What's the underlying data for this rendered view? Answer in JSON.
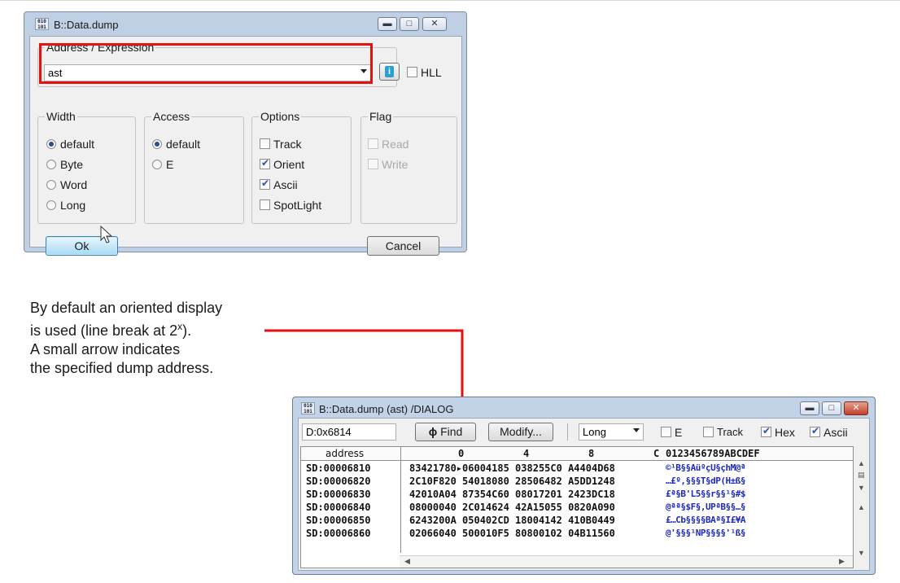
{
  "dialog1": {
    "title": "B::Data.dump",
    "app_icon_top": "010",
    "app_icon_bottom": "101",
    "window_buttons": [
      "minimize-icon",
      "maximize-icon",
      "close-icon"
    ],
    "address_group_label": "Address / Expression",
    "address_value": "ast",
    "hll_label": "HLL",
    "hll_checked": false,
    "width_group": {
      "label": "Width",
      "options": [
        "default",
        "Byte",
        "Word",
        "Long"
      ],
      "selected": "default"
    },
    "access_group": {
      "label": "Access",
      "options": [
        "default",
        "E"
      ],
      "selected": "default"
    },
    "options_group": {
      "label": "Options",
      "items": [
        {
          "label": "Track",
          "checked": false
        },
        {
          "label": "Orient",
          "checked": true
        },
        {
          "label": "Ascii",
          "checked": true
        },
        {
          "label": "SpotLight",
          "checked": false
        }
      ]
    },
    "flag_group": {
      "label": "Flag",
      "items": [
        {
          "label": "Read",
          "checked": false,
          "disabled": true
        },
        {
          "label": "Write",
          "checked": false,
          "disabled": true
        }
      ]
    },
    "ok_label": "Ok",
    "cancel_label": "Cancel"
  },
  "annotation": {
    "line1": "By default an oriented display",
    "line2_pre": "is used (line break at 2",
    "line2_sup": "x",
    "line2_post": ").",
    "line3": "A small arrow indicates",
    "line4": "the specified dump address.",
    "highlight_color": "#e31212"
  },
  "dialog2": {
    "title": "B::Data.dump (ast) /DIALOG",
    "address_field": "D:0x6814",
    "find_label": "Find",
    "modify_label": "Modify...",
    "width_select": "Long",
    "e_label": "E",
    "e_checked": false,
    "track_label": "Track",
    "track_checked": false,
    "hex_label": "Hex",
    "hex_checked": true,
    "ascii_label": "Ascii",
    "ascii_checked": true,
    "header": {
      "address": "address",
      "c0": "0",
      "c4": "4",
      "c8": "8",
      "cC": "C",
      "ascii": "0123456789ABCDEF"
    },
    "rows": [
      {
        "address": "SD:00006810",
        "hex": "83421780▸06004185 038255C0 A4404D68",
        "ascii": "©¹B§§AüºçU§çhM@ª"
      },
      {
        "address": "SD:00006820",
        "hex": "2C10F820 54018080 28506482 A5DD1248",
        "ascii": "…£º,§§§T§dP(H±ß§"
      },
      {
        "address": "SD:00006830",
        "hex": "42010A04 87354C60 08017201 2423DC18",
        "ascii": "£ª§B'L5§§r§§¹§#$"
      },
      {
        "address": "SD:00006840",
        "hex": "08000040 2C014624 42A15055 0820A090",
        "ascii": "@ªª§$F§,UPªB§§…§"
      },
      {
        "address": "SD:00006850",
        "hex": "6243200A 050402CD 18004142 410B0449",
        "ascii": "£…Cb§§§§BAª§I£¥A"
      },
      {
        "address": "SD:00006860",
        "hex": "02066040 500010F5 80800102 04B11560",
        "ascii": "@'§§§¹NP§§§§'¹ß§"
      }
    ]
  }
}
